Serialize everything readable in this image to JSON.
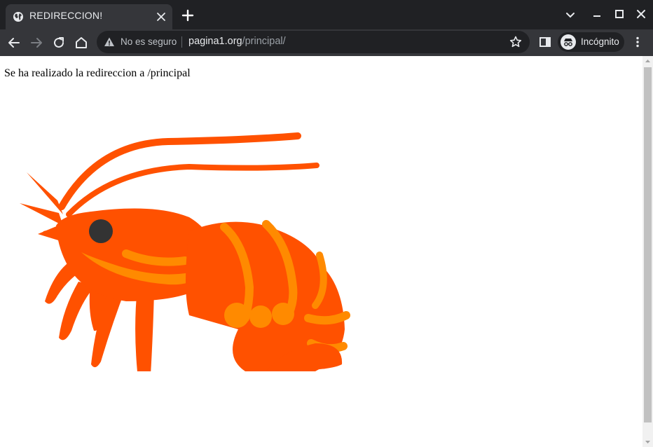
{
  "tab": {
    "title": "REDIRECCION!"
  },
  "omnibox": {
    "security_label": "No es seguro",
    "url_host": "pagina1.org",
    "url_path": "/principal/"
  },
  "profile": {
    "label": "Incógnito"
  },
  "page": {
    "message": "Se ha realizado la redireccion a /principal"
  },
  "icons": {
    "favicon": "globe-icon",
    "tab_close": "close-icon",
    "new_tab": "plus-icon",
    "back": "arrow-left-icon",
    "forward": "arrow-right-icon",
    "reload": "reload-icon",
    "home": "home-icon",
    "warning": "warning-icon",
    "bookmark": "star-icon",
    "side_panel": "side-panel-icon",
    "incognito": "incognito-icon",
    "menu": "kebab-menu-icon",
    "image": "shrimp-emoji"
  },
  "colors": {
    "tabstrip_bg": "#202124",
    "toolbar_bg": "#35363a",
    "omnibox_bg": "#202124",
    "shrimp_body": "#ff5100",
    "shrimp_accent": "#ff8a00"
  }
}
